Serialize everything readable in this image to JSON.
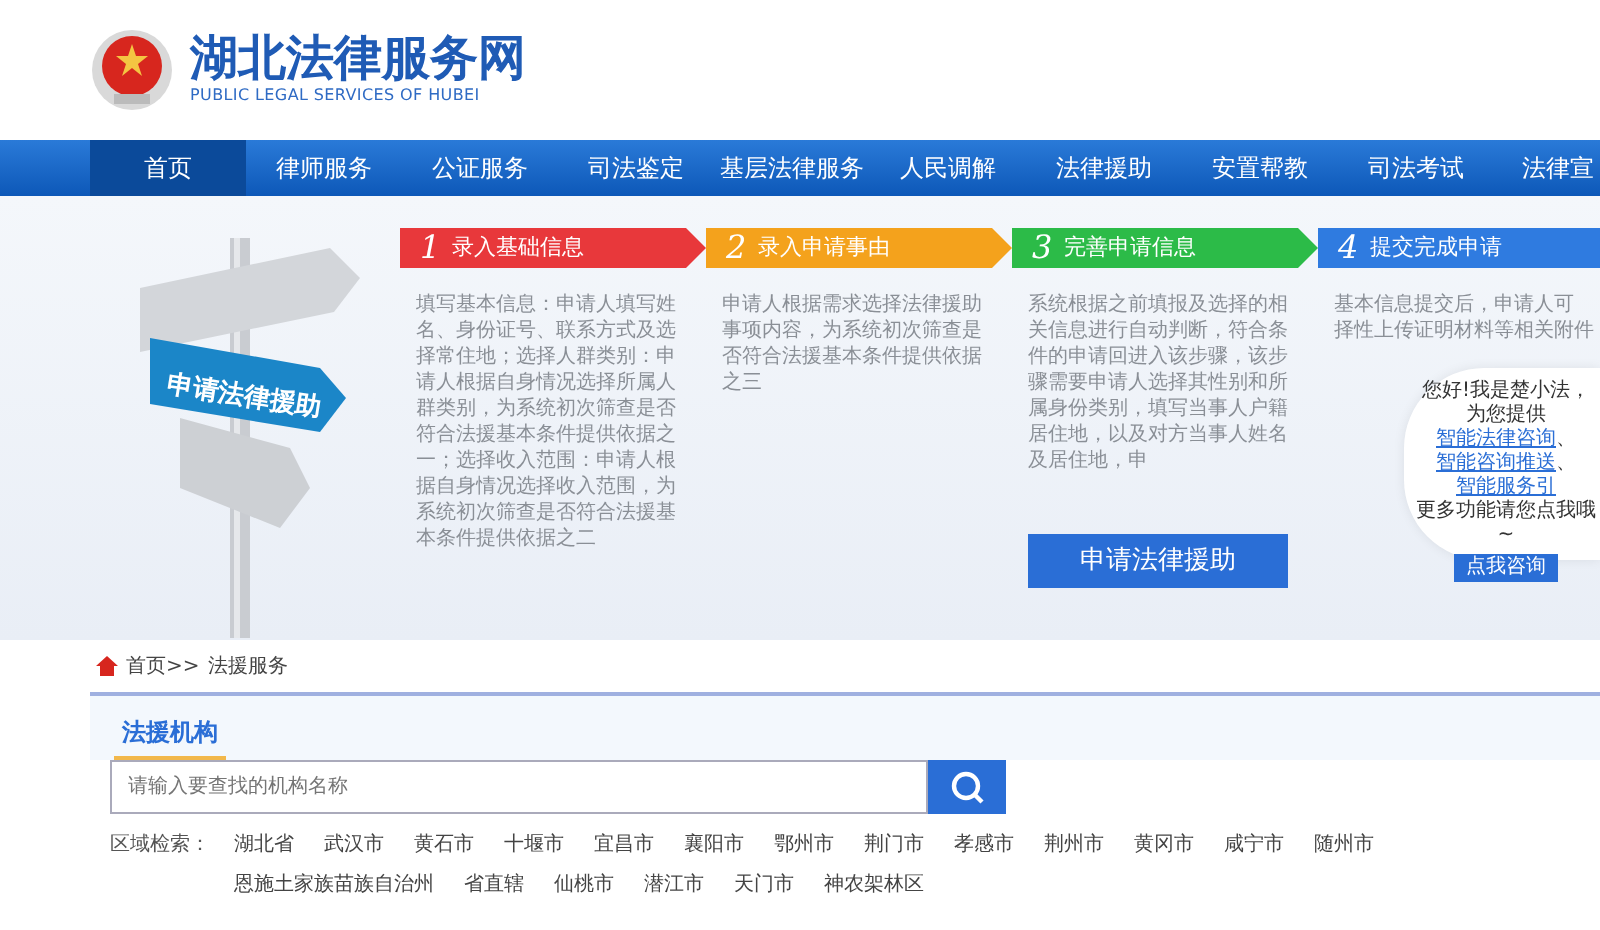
{
  "header": {
    "title": "湖北法律服务网",
    "subtitle": "PUBLIC LEGAL SERVICES OF HUBEI"
  },
  "nav": [
    {
      "label": "首页",
      "selected": true
    },
    {
      "label": "律师服务",
      "selected": false
    },
    {
      "label": "公证服务",
      "selected": false
    },
    {
      "label": "司法鉴定",
      "selected": false
    },
    {
      "label": "基层法律服务",
      "selected": false
    },
    {
      "label": "人民调解",
      "selected": false
    },
    {
      "label": "法律援助",
      "selected": false
    },
    {
      "label": "安置帮教",
      "selected": false
    },
    {
      "label": "司法考试",
      "selected": false
    },
    {
      "label": "法律宣",
      "selected": false
    }
  ],
  "hero": {
    "sign_text": "申请法律援助",
    "steps": [
      {
        "number": "1",
        "title": "录入基础信息",
        "color": "#e8383b",
        "description": [
          "填写基本信息：申请人填写姓名、身份证号、联系方式及选择常住地；选择人群类别：申请人根据自身情况选择所属人群类别，为系统初次筛查是否符合法援基本条件提供依据之一；选择收入范围：申请人根据自身情况选择收入范围，为系统初次筛查是否符合法援基本条件提供依据之二"
        ]
      },
      {
        "number": "2",
        "title": "录入申请事由",
        "color": "#f4a21c",
        "description": [
          "申请人根据需求选择法律援助事项内容，为系统初次筛查是否符合法援基本条件提供依据之三"
        ]
      },
      {
        "number": "3",
        "title": "完善申请信息",
        "color": "#2cbb48",
        "description": [
          "系统根据之前填报及选择的相关信息进行自动判断，符合条件的申请回进入该步骤，该步骤需要申请人选择其性别和所属身份类别，填写当事人户籍居住地，以及对方当事人姓名及居住地，申"
        ]
      },
      {
        "number": "4",
        "title": "提交完成申请",
        "color": "#2f7be0",
        "description": [
          "基本信息提交后，申请人可",
          "择性上传证明材料等相关附件"
        ]
      }
    ],
    "apply_button": "申请法律援助",
    "assistant": {
      "greeting": "您好!我是楚小法，",
      "intro": "为您提供",
      "links": [
        "智能法律咨询",
        "智能咨询推送",
        "智能服务引"
      ],
      "separator": "、",
      "more": "更多功能请您点我哦~",
      "button": "点我咨询"
    }
  },
  "breadcrumb": [
    "首页>>",
    "法援服务"
  ],
  "section_tab": "法援机构",
  "search": {
    "placeholder": "请输入要查找的机构名称"
  },
  "region_filter": {
    "label": "区域检索：",
    "options": [
      "湖北省",
      "武汉市",
      "黄石市",
      "十堰市",
      "宜昌市",
      "襄阳市",
      "鄂州市",
      "荆门市",
      "孝感市",
      "荆州市",
      "黄冈市",
      "咸宁市",
      "随州市",
      "恩施土家族苗族自治州",
      "省直辖",
      "仙桃市",
      "潜江市",
      "天门市",
      "神农架林区"
    ]
  }
}
